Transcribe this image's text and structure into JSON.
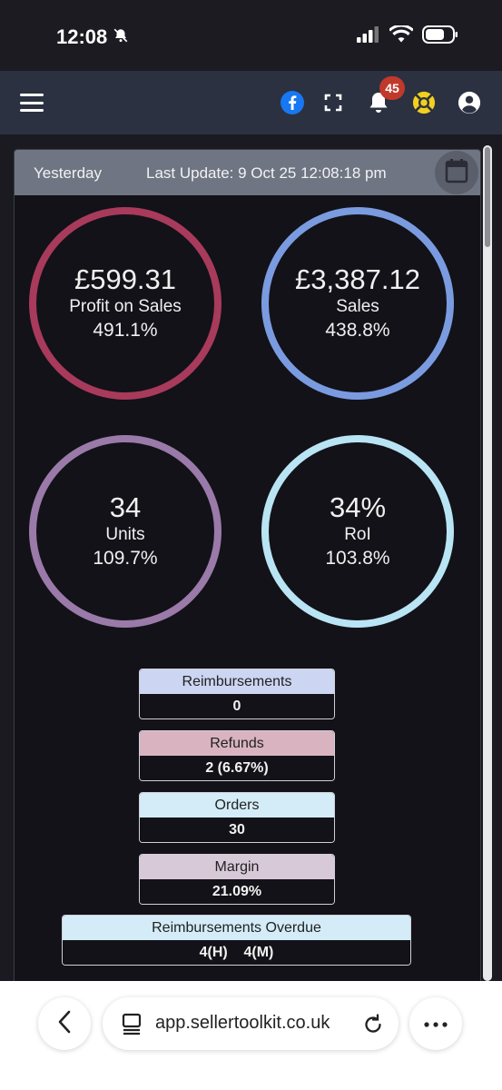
{
  "status_bar": {
    "time": "12:08"
  },
  "header": {
    "notification_count": "45"
  },
  "panel": {
    "period": "Yesterday",
    "last_update": "Last Update: 9 Oct 25 12:08:18 pm"
  },
  "metrics": [
    {
      "value": "£599.31",
      "label": "Profit on Sales",
      "change": "491.1%",
      "color": "#a83a5c"
    },
    {
      "value": "£3,387.12",
      "label": "Sales",
      "change": "438.8%",
      "color": "#7b9be0"
    },
    {
      "value": "34",
      "label": "Units",
      "change": "109.7%",
      "color": "#9a7aa8"
    },
    {
      "value": "34%",
      "label": "RoI",
      "change": "103.8%",
      "color": "#b9e4f3"
    }
  ],
  "stats": [
    {
      "label": "Reimbursements",
      "value": "0",
      "color": "#ccd6f2"
    },
    {
      "label": "Refunds",
      "value": "2 (6.67%)",
      "color": "#d9b3c0"
    },
    {
      "label": "Orders",
      "value": "30",
      "color": "#d4ecf7"
    },
    {
      "label": "Margin",
      "value": "21.09%",
      "color": "#d8c9d9"
    },
    {
      "label": "Reimbursements Overdue",
      "value": "4(H)    4(M)",
      "color": "#d4ecf7"
    }
  ],
  "browser": {
    "url": "app.sellertoolkit.co.uk"
  }
}
